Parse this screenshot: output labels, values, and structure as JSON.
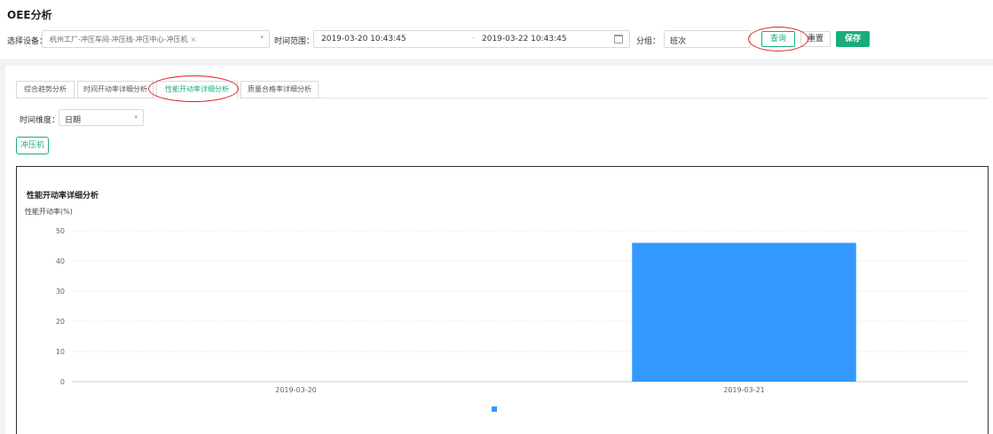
{
  "page": {
    "title": "OEE分析"
  },
  "filters": {
    "device_label": "选择设备：",
    "device_tag": "杭州工厂-冲压车间-冲压线-冲压中心-冲压机",
    "tag_close": "×",
    "select_arrow": "▾",
    "time_range_label": "时间范围：",
    "start": "2019-03-20 10:43:45",
    "range_separator": "-",
    "end": "2019-03-22 10:43:45",
    "group_label": "分组：",
    "group_value": "班次"
  },
  "buttons": {
    "query": "查询",
    "reset": "重置",
    "save": "保存"
  },
  "tabs": [
    {
      "label": "综合趋势分析",
      "active": false
    },
    {
      "label": "时间开动率详细分析",
      "active": false
    },
    {
      "label": "性能开动率详细分析",
      "active": true
    },
    {
      "label": "质量合格率详细分析",
      "active": false
    }
  ],
  "dimension": {
    "label": "时间维度：",
    "value": "日期",
    "arrow": "▾"
  },
  "machine_button": "冲压机",
  "colors": {
    "accent": "#1aad7a",
    "bar": "#3399ff",
    "annotation": "#e02020"
  },
  "chart_data": {
    "type": "bar",
    "title": "性能开动率详细分析",
    "ylabel": "性能开动率(%)",
    "xlabel": "",
    "categories": [
      "2019-03-20",
      "2019-03-21"
    ],
    "series": [
      {
        "name": "",
        "values": [
          0,
          46
        ]
      }
    ],
    "ylim": [
      0,
      50
    ],
    "yticks": [
      0,
      10,
      20,
      30,
      40,
      50
    ],
    "grid": true,
    "legend": "bottom-center"
  }
}
